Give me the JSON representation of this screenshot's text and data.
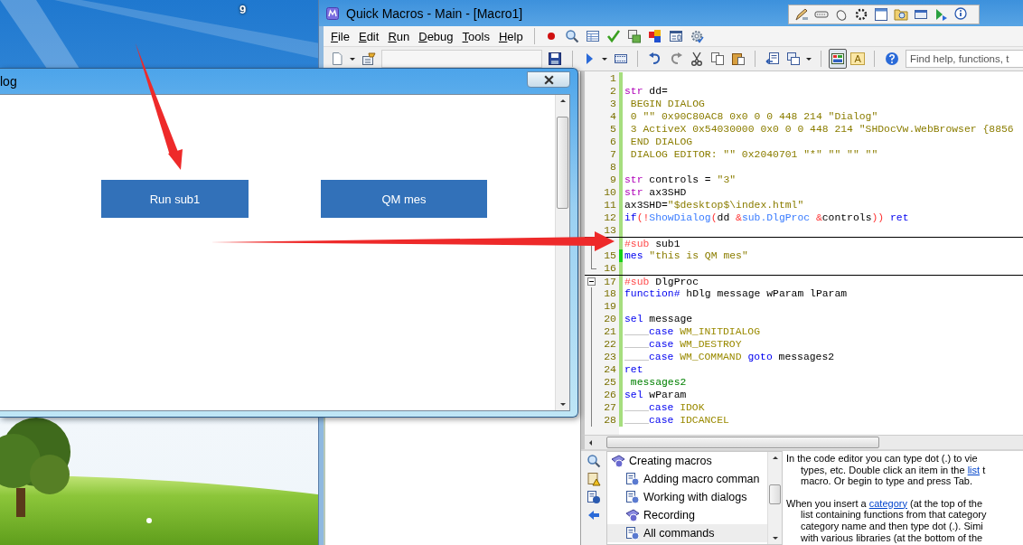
{
  "desktop": {
    "label": "9"
  },
  "dialog": {
    "title": "log",
    "buttons": [
      "Run sub1",
      "QM mes"
    ]
  },
  "quick_macros": {
    "title": "Quick Macros - Main - [Macro1]",
    "menu": [
      "File",
      "Edit",
      "Run",
      "Debug",
      "Tools",
      "Help"
    ],
    "view_buttons": [
      {
        "pressed": true
      },
      {
        "label": "A",
        "pressed": false
      }
    ],
    "search": {
      "placeholder": "Find help, functions, t"
    },
    "editor": {
      "lines": [
        {
          "n": "1",
          "sep": false,
          "changed": false
        },
        {
          "n": "2",
          "sep": false,
          "changed": false,
          "tokens": [
            {
              "kind": "type",
              "text": "str"
            },
            {
              "kind": "plain",
              "text": " dd="
            }
          ]
        },
        {
          "n": "3",
          "sep": false,
          "changed": false,
          "tokens": [
            {
              "kind": "string",
              "text": " BEGIN DIALOG"
            }
          ]
        },
        {
          "n": "4",
          "sep": false,
          "changed": false,
          "tokens": [
            {
              "kind": "string",
              "text": " 0 \"\" 0x90C80AC8 0x0 0 0 448 214 \"Dialog\""
            }
          ]
        },
        {
          "n": "5",
          "sep": false,
          "changed": false,
          "tokens": [
            {
              "kind": "string",
              "text": " 3 ActiveX 0x54030000 0x0 0 0 448 214 \"SHDocVw.WebBrowser {8856"
            }
          ]
        },
        {
          "n": "6",
          "sep": false,
          "changed": false,
          "tokens": [
            {
              "kind": "string",
              "text": " END DIALOG"
            }
          ]
        },
        {
          "n": "7",
          "sep": false,
          "changed": false,
          "tokens": [
            {
              "kind": "string",
              "text": " DIALOG EDITOR: \"\" 0x2040701 \"*\" \"\" \"\" \"\""
            }
          ]
        },
        {
          "n": "8",
          "sep": false,
          "changed": false
        },
        {
          "n": "9",
          "sep": false,
          "changed": false,
          "tokens": [
            {
              "kind": "type",
              "text": "str"
            },
            {
              "kind": "plain",
              "text": " controls = "
            },
            {
              "kind": "string",
              "text": "\"3\""
            }
          ]
        },
        {
          "n": "10",
          "sep": false,
          "changed": false,
          "tokens": [
            {
              "kind": "type",
              "text": "str"
            },
            {
              "kind": "plain",
              "text": " ax3SHD"
            }
          ]
        },
        {
          "n": "11",
          "sep": false,
          "changed": false,
          "tokens": [
            {
              "kind": "plain",
              "text": "ax3SHD="
            },
            {
              "kind": "string",
              "text": "\"$desktop$\\index.html\""
            }
          ]
        },
        {
          "n": "12",
          "sep": false,
          "changed": false,
          "tokens": [
            {
              "kind": "keyword",
              "text": "if"
            },
            {
              "kind": "operator",
              "text": "(!"
            },
            {
              "kind": "function",
              "text": "ShowDialog"
            },
            {
              "kind": "operator",
              "text": "("
            },
            {
              "kind": "plain",
              "text": "dd "
            },
            {
              "kind": "operator",
              "text": "&"
            },
            {
              "kind": "function",
              "text": "sub.DlgProc"
            },
            {
              "kind": "operator",
              "text": " &"
            },
            {
              "kind": "plain",
              "text": "controls"
            },
            {
              "kind": "operator",
              "text": "))"
            },
            {
              "kind": "keyword",
              "text": " ret"
            }
          ]
        },
        {
          "n": "13",
          "sep": false,
          "changed": false
        },
        {
          "sep": true,
          "changed": false,
          "fold": {
            "kind": "mid"
          },
          "tokens": [
            {
              "kind": "directive",
              "text": "#sub"
            },
            {
              "kind": "plain",
              "text": " sub1"
            }
          ]
        },
        {
          "n": "15",
          "sep": false,
          "changed": true,
          "fold": {
            "kind": "mid"
          },
          "tokens": [
            {
              "kind": "keyword",
              "text": "mes"
            },
            {
              "kind": "string",
              "text": " \"this is QM mes\""
            }
          ]
        },
        {
          "n": "16",
          "sep": false,
          "changed": false,
          "fold": {
            "kind": "end"
          }
        },
        {
          "n": "17",
          "sep": true,
          "changed": false,
          "fold": {
            "kind": "start"
          },
          "tokens": [
            {
              "kind": "directive",
              "text": "#sub"
            },
            {
              "kind": "plain",
              "text": " DlgProc"
            }
          ]
        },
        {
          "n": "18",
          "sep": false,
          "changed": false,
          "fold": {
            "kind": "mid"
          },
          "tokens": [
            {
              "kind": "keyword",
              "text": "function#"
            },
            {
              "kind": "plain",
              "text": " hDlg message wParam lParam"
            }
          ]
        },
        {
          "n": "19",
          "sep": false,
          "changed": false,
          "fold": {
            "kind": "mid"
          }
        },
        {
          "n": "20",
          "sep": false,
          "changed": false,
          "fold": {
            "kind": "mid"
          },
          "tokens": [
            {
              "kind": "keyword",
              "text": "sel"
            },
            {
              "kind": "plain",
              "text": " message"
            }
          ]
        },
        {
          "n": "21",
          "sep": false,
          "changed": false,
          "fold": {
            "kind": "mid"
          },
          "tokens": [
            {
              "kind": "tab"
            },
            {
              "kind": "keyword",
              "text": "case"
            },
            {
              "kind": "constant",
              "text": " WM_INITDIALOG"
            }
          ]
        },
        {
          "n": "22",
          "sep": false,
          "changed": false,
          "fold": {
            "kind": "mid"
          },
          "tokens": [
            {
              "kind": "tab"
            },
            {
              "kind": "keyword",
              "text": "case"
            },
            {
              "kind": "constant",
              "text": " WM_DESTROY"
            }
          ]
        },
        {
          "n": "23",
          "sep": false,
          "changed": false,
          "fold": {
            "kind": "mid"
          },
          "tokens": [
            {
              "kind": "tab"
            },
            {
              "kind": "keyword",
              "text": "case"
            },
            {
              "kind": "constant",
              "text": " WM_COMMAND"
            },
            {
              "kind": "keyword",
              "text": " goto"
            },
            {
              "kind": "plain",
              "text": " messages2"
            }
          ]
        },
        {
          "n": "24",
          "sep": false,
          "changed": false,
          "fold": {
            "kind": "mid"
          },
          "tokens": [
            {
              "kind": "keyword",
              "text": "ret"
            }
          ]
        },
        {
          "n": "25",
          "sep": false,
          "changed": false,
          "fold": {
            "kind": "mid"
          },
          "tokens": [
            {
              "kind": "label",
              "text": " messages2"
            }
          ]
        },
        {
          "n": "26",
          "sep": false,
          "changed": false,
          "fold": {
            "kind": "mid"
          },
          "tokens": [
            {
              "kind": "keyword",
              "text": "sel"
            },
            {
              "kind": "plain",
              "text": " wParam"
            }
          ]
        },
        {
          "n": "27",
          "sep": false,
          "changed": false,
          "fold": {
            "kind": "mid"
          },
          "tokens": [
            {
              "kind": "tab"
            },
            {
              "kind": "keyword",
              "text": "case"
            },
            {
              "kind": "constant",
              "text": " IDOK"
            }
          ]
        },
        {
          "n": "28",
          "sep": false,
          "changed": false,
          "fold": {
            "kind": "mid"
          },
          "tokens": [
            {
              "kind": "tab"
            },
            {
              "kind": "keyword",
              "text": "case"
            },
            {
              "kind": "constant",
              "text": " IDCANCEL"
            }
          ]
        }
      ]
    },
    "help_tree": [
      {
        "label": "Creating macros",
        "kind": "book",
        "selected": false,
        "children": [
          {
            "label": "Adding macro comman",
            "kind": "page",
            "selected": false
          },
          {
            "label": "Working with dialogs",
            "kind": "page",
            "selected": false
          },
          {
            "label": "Recording",
            "kind": "book",
            "selected": false
          },
          {
            "label": "All commands",
            "kind": "page",
            "selected": true
          }
        ]
      }
    ],
    "help_text": [
      {
        "lines": [
          [
            {
              "text": "In the code editor you can type dot (.) to vie",
              "link": false
            }
          ],
          [
            {
              "text": "types, etc. Double click an item in the ",
              "link": false
            },
            {
              "text": "list",
              "link": true
            },
            {
              "text": " t",
              "link": false
            }
          ],
          [
            {
              "text": "macro. Or begin to type and press Tab.",
              "link": false
            }
          ]
        ]
      },
      {
        "lines": [
          [
            {
              "text": "When you insert a ",
              "link": false
            },
            {
              "text": "category",
              "link": true
            },
            {
              "text": " (at the top of the",
              "link": false
            }
          ],
          [
            {
              "text": "list containing functions from that category",
              "link": false
            }
          ],
          [
            {
              "text": "category name and then type dot (.). Simi",
              "link": false
            }
          ],
          [
            {
              "text": "with various libraries (at the bottom of the",
              "link": false
            }
          ]
        ]
      }
    ]
  }
}
